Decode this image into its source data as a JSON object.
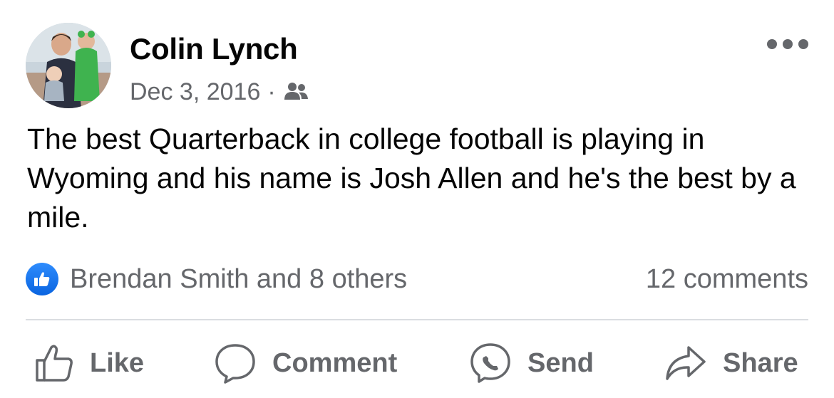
{
  "post": {
    "author": "Colin Lynch",
    "date": "Dec 3, 2016",
    "separator": "·",
    "audience_icon": "friends-icon",
    "text": "The best Quarterback in college football is playing in Wyoming and his name is Josh Allen and he's the best by a mile."
  },
  "summary": {
    "reaction_icon": "like-reaction-icon",
    "reactions_text": "Brendan Smith and 8 others",
    "comments_text": "12 comments"
  },
  "actions": [
    {
      "label": "Like",
      "icon": "thumbs-up-icon"
    },
    {
      "label": "Comment",
      "icon": "comment-bubble-icon"
    },
    {
      "label": "Send",
      "icon": "messenger-icon"
    },
    {
      "label": "Share",
      "icon": "share-arrow-icon"
    }
  ],
  "colors": {
    "text_primary": "#050505",
    "text_secondary": "#65676b",
    "like_blue": "#0866ff",
    "divider": "#dadde1"
  }
}
